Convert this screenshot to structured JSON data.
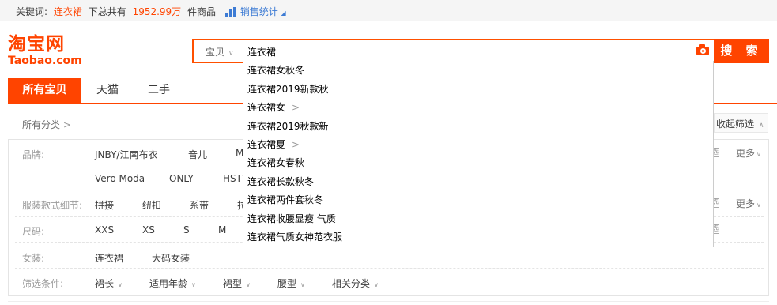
{
  "keyword_bar": {
    "prefix": "关键词:",
    "keyword": "连衣裙",
    "middle": "下总共有",
    "count": "1952.99万",
    "suffix": "件商品",
    "sales_stats": "销售统计"
  },
  "logo": {
    "cn": "淘宝网",
    "en": "Taobao.com"
  },
  "search": {
    "type_label": "宝贝",
    "value": "连衣裙",
    "button_label": "搜 索"
  },
  "tabs": [
    {
      "label": "所有宝贝",
      "active": true
    },
    {
      "label": "天猫",
      "active": false
    },
    {
      "label": "二手",
      "active": false
    }
  ],
  "category": {
    "all_label": "所有分类",
    "collapse_label": "收起筛选"
  },
  "filters": {
    "brand": {
      "label": "品牌:",
      "row1": [
        "JNBY/江南布衣",
        "音儿",
        "M"
      ],
      "row2": [
        "Vero Moda",
        "ONLY",
        "HSTY"
      ],
      "more": "更多"
    },
    "style": {
      "label": "服装款式细节:",
      "items": [
        "拼接",
        "纽扣",
        "系带",
        "拉"
      ],
      "more": "更多"
    },
    "size": {
      "label": "尺码:",
      "items": [
        "XXS",
        "XS",
        "S",
        "M"
      ]
    },
    "women": {
      "label": "女装:",
      "items": [
        "连衣裙",
        "大码女装"
      ]
    },
    "conditions": {
      "label": "筛选条件:",
      "items": [
        "裙长",
        "适用年龄",
        "裙型",
        "腰型",
        "相关分类"
      ]
    }
  },
  "suggestions": [
    {
      "text": "连衣裙女秋冬",
      "has_more": false
    },
    {
      "text": "连衣裙2019新款秋",
      "has_more": false
    },
    {
      "text": "连衣裙女",
      "has_more": true
    },
    {
      "text": "连衣裙2019秋款新",
      "has_more": false
    },
    {
      "text": "连衣裙夏",
      "has_more": true
    },
    {
      "text": "连衣裙女春秋",
      "has_more": false
    },
    {
      "text": "连衣裙长款秋冬",
      "has_more": false
    },
    {
      "text": "连衣裙两件套秋冬",
      "has_more": false
    },
    {
      "text": "连衣裙收腰显瘦 气质",
      "has_more": false
    },
    {
      "text": "连衣裙气质女神范衣服",
      "has_more": false
    }
  ],
  "colors": {
    "accent": "#ff4400",
    "link": "#3d7bd4"
  }
}
